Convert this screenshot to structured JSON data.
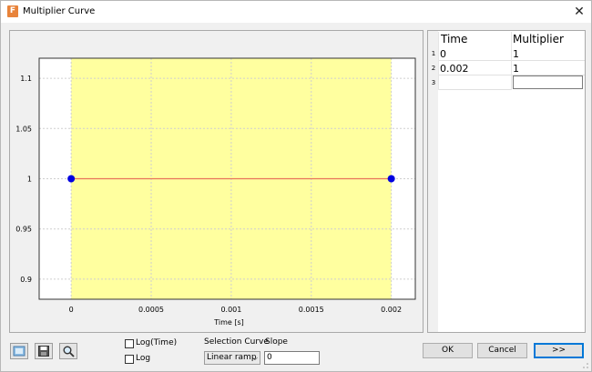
{
  "window": {
    "title": "Multiplier Curve",
    "app_icon_letter": "F",
    "close_glyph": "✕"
  },
  "chart_data": {
    "type": "line",
    "x": [
      0,
      0.002
    ],
    "series": [
      {
        "values": [
          1,
          1
        ]
      }
    ],
    "xlabel": "Time [s]",
    "ylabel": "",
    "xlim": [
      -0.0002,
      0.00215
    ],
    "ylim": [
      0.88,
      1.12
    ],
    "x_ticks": [
      0,
      0.0005,
      0.001,
      0.0015,
      0.002
    ],
    "x_tick_labels": [
      "0",
      "0.0005",
      "0.001",
      "0.0015",
      "0.002"
    ],
    "y_ticks": [
      0.9,
      0.95,
      1,
      1.05,
      1.1
    ],
    "y_tick_labels": [
      "0.9",
      "0.95",
      "1",
      "1.05",
      "1.1"
    ],
    "highlight_range": [
      0,
      0.002
    ],
    "grid": true,
    "colors": {
      "highlight": "#ffff9f",
      "line": "#e8735a",
      "point": "#0000e0",
      "plot_bg": "#ffffff",
      "grid": "#cfcfcf"
    }
  },
  "table": {
    "columns": [
      "Time",
      "Multiplier"
    ],
    "rows": [
      {
        "num": "1",
        "time": "0",
        "multiplier": "1"
      },
      {
        "num": "2",
        "time": "0.002",
        "multiplier": "1"
      },
      {
        "num": "3",
        "time": "",
        "multiplier": ""
      }
    ]
  },
  "toolbar": {
    "icons": [
      "image-icon",
      "save-icon",
      "zoom-icon"
    ]
  },
  "options": {
    "log_time_label": "Log(Time)",
    "log_label": "Log",
    "selection_curve_label": "Selection Curve",
    "selection_curve_value": "Linear ramp",
    "slope_label": "Slope",
    "slope_value": "0"
  },
  "buttons": {
    "ok": "OK",
    "cancel": "Cancel",
    "next": ">>"
  }
}
